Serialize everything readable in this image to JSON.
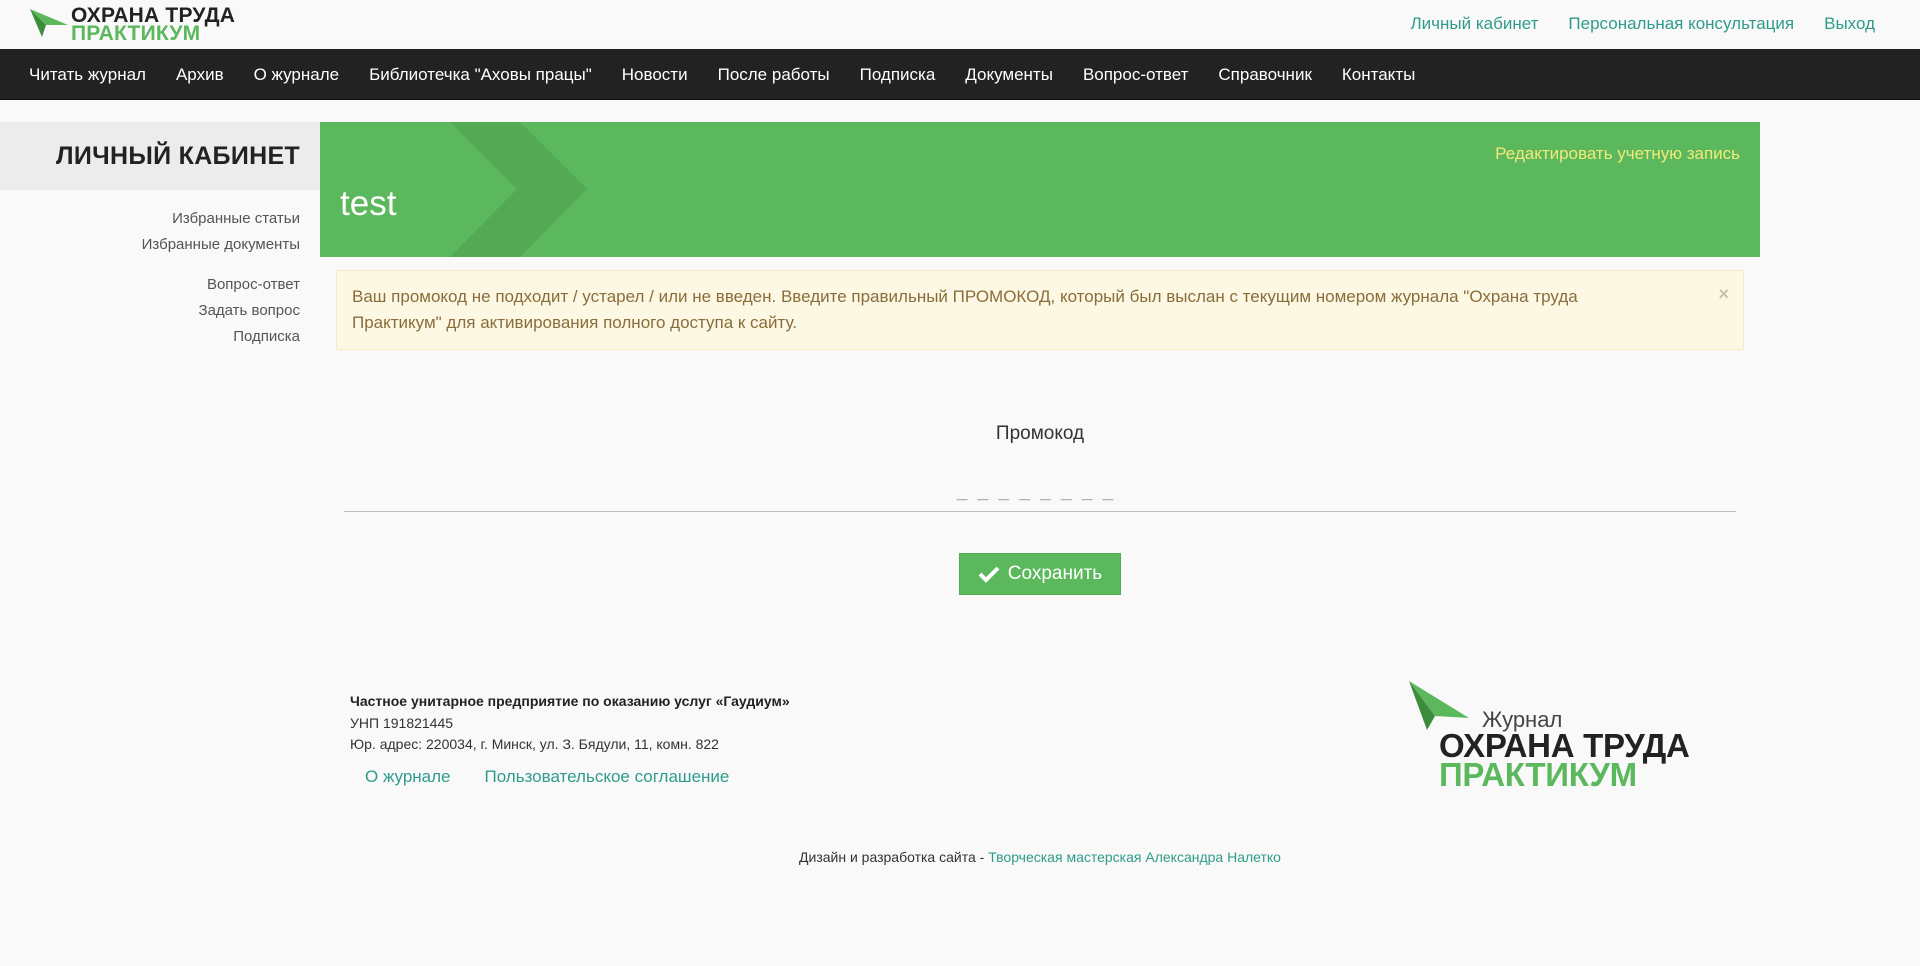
{
  "header": {
    "logo_line1": "ОХРАНА ТРУДА",
    "logo_line2": "ПРАКТИКУМ",
    "links": [
      "Личный кабинет",
      "Персональная консультация",
      "Выход"
    ]
  },
  "nav": {
    "items": [
      "Читать журнал",
      "Архив",
      "О журнале",
      "Библиотечка \"Аховы працы\"",
      "Новости",
      "После работы",
      "Подписка",
      "Документы",
      "Вопрос-ответ",
      "Справочник",
      "Контакты"
    ]
  },
  "sidebar": {
    "title": "ЛИЧНЫЙ КАБИНЕТ",
    "group1": [
      "Избранные статьи",
      "Избранные документы"
    ],
    "group2": [
      "Вопрос-ответ",
      "Задать вопрос",
      "Подписка"
    ]
  },
  "banner": {
    "username": "test",
    "edit_link": "Редактировать учетную запись"
  },
  "alert": {
    "message": "Ваш промокод не подходит / устарел / или не введен. Введите правильный ПРОМОКОД, который был выслан с текущим номером журнала \"Охрана труда Практикум\" для активирования полного доступа к сайту.",
    "close": "×"
  },
  "form": {
    "label": "Промокод",
    "placeholder": "________",
    "save_label": "Сохранить"
  },
  "footer": {
    "company": "Частное унитарное предприятие по оказанию услуг «Гаудиум»",
    "unp": "УНП 191821445",
    "address": "Юр. адрес: 220034, г. Минск, ул. З. Бядули, 11, комн. 822",
    "links": [
      "О журнале",
      "Пользовательское соглашение"
    ],
    "logo_small": "Журнал",
    "logo_line1": "ОХРАНА ТРУДА",
    "logo_line2": "ПРАКТИКУМ",
    "credits_prefix": "Дизайн и разработка сайта - ",
    "credits_link": "Творческая мастерская Александра Налетко"
  },
  "colors": {
    "accent_green": "#5cb85c",
    "link_teal": "#2f9c8b",
    "nav_bg": "#222222",
    "alert_bg": "#fcf8e3",
    "edit_link_yellow": "#f3e97a"
  }
}
